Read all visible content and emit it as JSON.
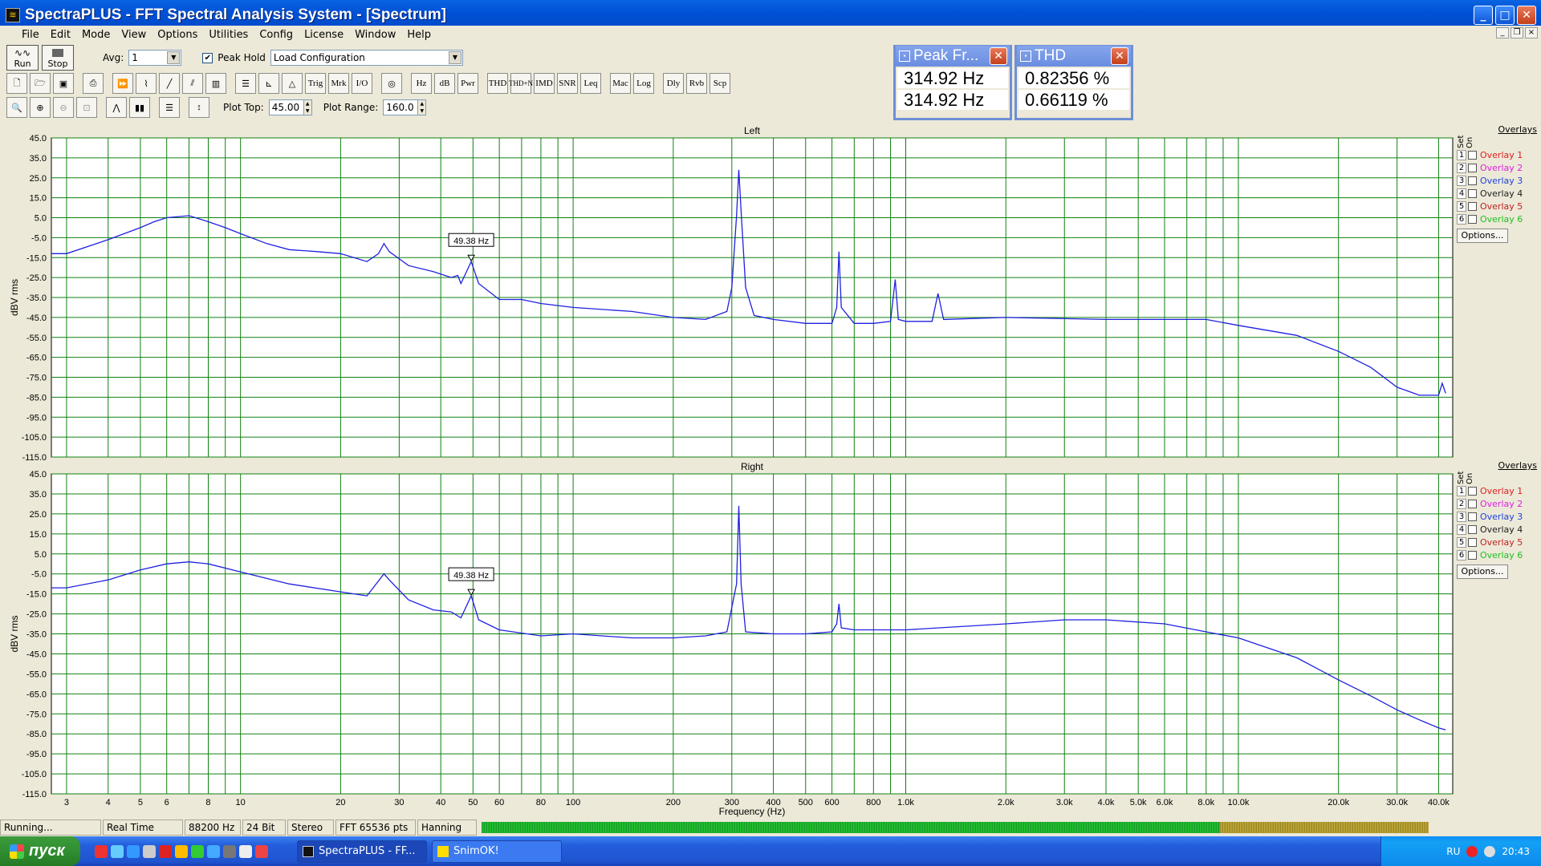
{
  "window": {
    "title": "SpectraPLUS - FFT Spectral Analysis System - [Spectrum]"
  },
  "menu": [
    "File",
    "Edit",
    "Mode",
    "View",
    "Options",
    "Utilities",
    "Config",
    "License",
    "Window",
    "Help"
  ],
  "toolbar": {
    "run_label": "Run",
    "stop_label": "Stop",
    "avg_label": "Avg:",
    "avg_value": "1",
    "peak_hold_label": "Peak Hold",
    "peak_hold_checked": true,
    "config_value": "Load Configuration",
    "row2_buttons": [
      "Hz",
      "dB",
      "Pwr",
      "THD",
      "THD+N",
      "IMD",
      "SNR",
      "Leq",
      "Mac",
      "Log",
      "Dly",
      "Rvb",
      "Scp"
    ],
    "plot_top_label": "Plot Top:",
    "plot_top_value": "45.00",
    "plot_range_label": "Plot Range:",
    "plot_range_value": "160.0"
  },
  "meters": {
    "peak": {
      "title": "Peak Fr...",
      "values": [
        "314.92 Hz",
        "314.92 Hz"
      ]
    },
    "thd": {
      "title": "THD",
      "values": [
        "0.82356 %",
        "0.66119 %"
      ]
    }
  },
  "overlays": {
    "header": "Overlays",
    "set_label": "Set",
    "on_label": "On",
    "items": [
      {
        "num": "1",
        "label": "Overlay 1",
        "color": "#e02020"
      },
      {
        "num": "2",
        "label": "Overlay 2",
        "color": "#e020e0"
      },
      {
        "num": "3",
        "label": "Overlay 3",
        "color": "#2040e0"
      },
      {
        "num": "4",
        "label": "Overlay 4",
        "color": "#202020"
      },
      {
        "num": "5",
        "label": "Overlay 5",
        "color": "#c02020"
      },
      {
        "num": "6",
        "label": "Overlay 6",
        "color": "#20c020"
      }
    ],
    "options_label": "Options..."
  },
  "chart_data": [
    {
      "type": "line",
      "title": "Left",
      "ylabel": "dBV rms",
      "xlabel": "Frequency (Hz)",
      "x_scale": "log",
      "xlim": [
        2.7,
        44100
      ],
      "ylim": [
        -115,
        45
      ],
      "yticks": [
        "45.0",
        "35.0",
        "25.0",
        "15.0",
        "5.0",
        "-5.0",
        "-15.0",
        "-25.0",
        "-35.0",
        "-45.0",
        "-55.0",
        "-65.0",
        "-75.0",
        "-85.0",
        "-95.0",
        "-105.0",
        "-115.0"
      ],
      "marker_label": "49.38 Hz",
      "series": [
        {
          "color": "#2020e0",
          "points": [
            [
              2.7,
              -13
            ],
            [
              3,
              -13
            ],
            [
              4,
              -6
            ],
            [
              5,
              0
            ],
            [
              5.5,
              3
            ],
            [
              6,
              5
            ],
            [
              7,
              6
            ],
            [
              8,
              3
            ],
            [
              9,
              0
            ],
            [
              10,
              -3
            ],
            [
              12,
              -8
            ],
            [
              14,
              -11
            ],
            [
              17,
              -12
            ],
            [
              20,
              -13
            ],
            [
              24,
              -17
            ],
            [
              26,
              -13
            ],
            [
              27,
              -8
            ],
            [
              28,
              -12
            ],
            [
              32,
              -19
            ],
            [
              38,
              -22
            ],
            [
              43,
              -25
            ],
            [
              45,
              -24
            ],
            [
              46,
              -28
            ],
            [
              49.38,
              -17
            ],
            [
              52,
              -28
            ],
            [
              60,
              -36
            ],
            [
              70,
              -36
            ],
            [
              80,
              -38
            ],
            [
              100,
              -40
            ],
            [
              150,
              -42
            ],
            [
              200,
              -45
            ],
            [
              250,
              -46
            ],
            [
              290,
              -42
            ],
            [
              300,
              -30
            ],
            [
              310,
              6
            ],
            [
              314.92,
              29
            ],
            [
              320,
              8
            ],
            [
              330,
              -30
            ],
            [
              350,
              -44
            ],
            [
              400,
              -46
            ],
            [
              500,
              -48
            ],
            [
              600,
              -48
            ],
            [
              620,
              -40
            ],
            [
              630,
              -12
            ],
            [
              640,
              -40
            ],
            [
              700,
              -48
            ],
            [
              800,
              -48
            ],
            [
              900,
              -47
            ],
            [
              930,
              -26
            ],
            [
              950,
              -46
            ],
            [
              1000,
              -47
            ],
            [
              1200,
              -47
            ],
            [
              1250,
              -33
            ],
            [
              1300,
              -46
            ],
            [
              2000,
              -45
            ],
            [
              4000,
              -46
            ],
            [
              6000,
              -46
            ],
            [
              8000,
              -46
            ],
            [
              10000,
              -49
            ],
            [
              15000,
              -54
            ],
            [
              20000,
              -62
            ],
            [
              25000,
              -70
            ],
            [
              30000,
              -80
            ],
            [
              35000,
              -84
            ],
            [
              40000,
              -84
            ],
            [
              41000,
              -78
            ],
            [
              42000,
              -83
            ]
          ]
        }
      ]
    },
    {
      "type": "line",
      "title": "Right",
      "ylabel": "dBV rms",
      "xlabel": "Frequency (Hz)",
      "x_scale": "log",
      "xlim": [
        2.7,
        44100
      ],
      "ylim": [
        -115,
        45
      ],
      "yticks": [
        "45.0",
        "35.0",
        "25.0",
        "15.0",
        "5.0",
        "-5.0",
        "-15.0",
        "-25.0",
        "-35.0",
        "-45.0",
        "-55.0",
        "-65.0",
        "-75.0",
        "-85.0",
        "-95.0",
        "-105.0",
        "-115.0"
      ],
      "xticks": [
        "3",
        "4",
        "5",
        "6",
        "8",
        "10",
        "20",
        "30",
        "40",
        "50",
        "60",
        "80",
        "100",
        "200",
        "300",
        "400",
        "500",
        "600",
        "800",
        "1.0k",
        "2.0k",
        "3.0k",
        "4.0k",
        "5.0k",
        "6.0k",
        "8.0k",
        "10.0k",
        "20.0k",
        "30.0k",
        "40.0k"
      ],
      "marker_label": "49.38 Hz",
      "series": [
        {
          "color": "#2020e0",
          "points": [
            [
              2.7,
              -12
            ],
            [
              3,
              -12
            ],
            [
              4,
              -8
            ],
            [
              5,
              -3
            ],
            [
              6,
              0
            ],
            [
              7,
              1
            ],
            [
              8,
              0
            ],
            [
              10,
              -4
            ],
            [
              14,
              -10
            ],
            [
              20,
              -14
            ],
            [
              24,
              -16
            ],
            [
              27,
              -5
            ],
            [
              28,
              -8
            ],
            [
              32,
              -18
            ],
            [
              38,
              -23
            ],
            [
              43,
              -24
            ],
            [
              46,
              -27
            ],
            [
              49.38,
              -16
            ],
            [
              52,
              -28
            ],
            [
              60,
              -33
            ],
            [
              80,
              -36
            ],
            [
              100,
              -35
            ],
            [
              150,
              -37
            ],
            [
              200,
              -37
            ],
            [
              250,
              -36
            ],
            [
              290,
              -34
            ],
            [
              310,
              -10
            ],
            [
              314.92,
              29
            ],
            [
              320,
              -10
            ],
            [
              330,
              -34
            ],
            [
              400,
              -35
            ],
            [
              500,
              -35
            ],
            [
              600,
              -34
            ],
            [
              620,
              -30
            ],
            [
              630,
              -20
            ],
            [
              640,
              -32
            ],
            [
              700,
              -33
            ],
            [
              1000,
              -33
            ],
            [
              2000,
              -30
            ],
            [
              3000,
              -28
            ],
            [
              4000,
              -28
            ],
            [
              6000,
              -30
            ],
            [
              8000,
              -34
            ],
            [
              10000,
              -37
            ],
            [
              15000,
              -47
            ],
            [
              20000,
              -58
            ],
            [
              25000,
              -66
            ],
            [
              30000,
              -73
            ],
            [
              35000,
              -78
            ],
            [
              40000,
              -82
            ],
            [
              42000,
              -83
            ]
          ]
        }
      ]
    }
  ],
  "status": {
    "state": "Running...",
    "mode": "Real Time",
    "rate": "88200 Hz",
    "bits": "24 Bit",
    "channels": "Stereo",
    "fft": "FFT 65536 pts",
    "window": "Hanning"
  },
  "taskbar": {
    "start_label": "пуск",
    "tasks": [
      "SpectraPLUS - FF...",
      "SnimOK!"
    ],
    "lang": "RU",
    "clock": "20:43"
  }
}
